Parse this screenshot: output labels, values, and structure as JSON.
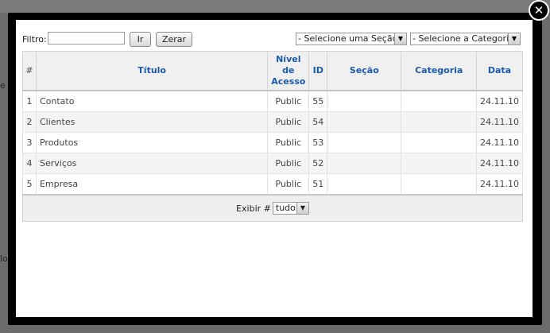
{
  "background": {
    "left_labels": [
      "e",
      "lo"
    ]
  },
  "close_icon_glyph": "✕",
  "toolbar": {
    "filter_label": "Filtro:",
    "filter_value": "",
    "go_label": "Ir",
    "reset_label": "Zerar",
    "section_select": "- Selecione uma Seção -",
    "category_select": "- Selecione a Categoria -",
    "dropdown_icon": "▼"
  },
  "table": {
    "headers": {
      "num": "#",
      "title": "Título",
      "access": "Nível de Acesso",
      "id": "ID",
      "section": "Seção",
      "category": "Categoria",
      "date": "Data"
    },
    "rows": [
      {
        "num": "1",
        "title": "Contato",
        "access": "Public",
        "id": "55",
        "section": "",
        "category": "",
        "date": "24.11.10"
      },
      {
        "num": "2",
        "title": "Clientes",
        "access": "Public",
        "id": "54",
        "section": "",
        "category": "",
        "date": "24.11.10"
      },
      {
        "num": "3",
        "title": "Produtos",
        "access": "Public",
        "id": "53",
        "section": "",
        "category": "",
        "date": "24.11.10"
      },
      {
        "num": "4",
        "title": "Serviços",
        "access": "Public",
        "id": "52",
        "section": "",
        "category": "",
        "date": "24.11.10"
      },
      {
        "num": "5",
        "title": "Empresa",
        "access": "Public",
        "id": "51",
        "section": "",
        "category": "",
        "date": "24.11.10"
      }
    ]
  },
  "footer": {
    "display_label": "Exibir #",
    "limit_value": "tudo"
  },
  "colors": {
    "header_text": "#1b5aa7",
    "overlay": "#6b6b6b",
    "modal_frame": "#000000"
  }
}
